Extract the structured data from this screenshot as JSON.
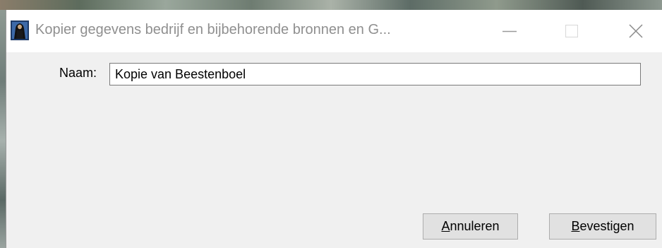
{
  "window": {
    "title": "Kopier gegevens bedrijf en bijbehorende bronnen en G...",
    "app_icon": "dark-figure-app-icon",
    "controls": {
      "minimize_icon": "minimize-icon",
      "maximize_icon": "maximize-icon",
      "close_icon": "close-icon"
    }
  },
  "form": {
    "name_label": "Naam:",
    "name_value": "Kopie van Beestenboel"
  },
  "buttons": {
    "cancel_mnemonic": "A",
    "cancel_rest": "nnuleren",
    "confirm_mnemonic": "B",
    "confirm_rest": "evestigen"
  }
}
